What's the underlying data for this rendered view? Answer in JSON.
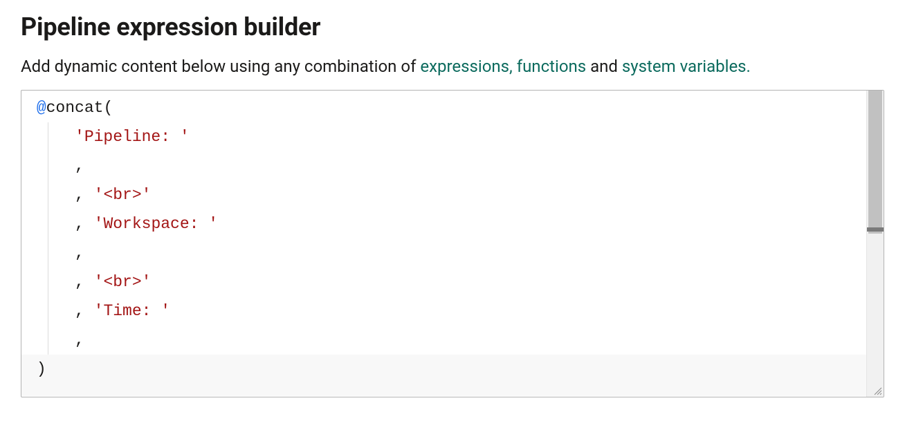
{
  "title": "Pipeline expression builder",
  "description": {
    "prefix": "Add dynamic content below using any combination of ",
    "link_expressions": "expressions,",
    "link_functions": "functions",
    "mid": " and ",
    "link_sysvars": "system variables.",
    "suffix": ""
  },
  "code": {
    "at": "@",
    "fn": "concat",
    "open_paren": "(",
    "close_paren": ")",
    "comma": ",",
    "lines": [
      {
        "indent": 0,
        "parts": [
          {
            "t": "at"
          },
          {
            "t": "fn"
          },
          {
            "t": "open_paren"
          }
        ]
      },
      {
        "indent": 1,
        "parts": [
          {
            "t": "string",
            "v": "'Pipeline: '"
          }
        ]
      },
      {
        "indent": 1,
        "parts": [
          {
            "t": "comma"
          }
        ]
      },
      {
        "indent": 1,
        "parts": [
          {
            "t": "comma"
          },
          {
            "t": "sp"
          },
          {
            "t": "string",
            "v": "'<br>'"
          }
        ]
      },
      {
        "indent": 1,
        "parts": [
          {
            "t": "comma"
          },
          {
            "t": "sp"
          },
          {
            "t": "string",
            "v": "'Workspace: '"
          }
        ]
      },
      {
        "indent": 1,
        "parts": [
          {
            "t": "comma"
          }
        ]
      },
      {
        "indent": 1,
        "parts": [
          {
            "t": "comma"
          },
          {
            "t": "sp"
          },
          {
            "t": "string",
            "v": "'<br>'"
          }
        ]
      },
      {
        "indent": 1,
        "parts": [
          {
            "t": "comma"
          },
          {
            "t": "sp"
          },
          {
            "t": "string",
            "v": "'Time: '"
          }
        ]
      },
      {
        "indent": 1,
        "parts": [
          {
            "t": "comma"
          }
        ]
      },
      {
        "indent": 0,
        "parts": [
          {
            "t": "close_paren"
          }
        ]
      }
    ],
    "indent_unit": "    "
  }
}
